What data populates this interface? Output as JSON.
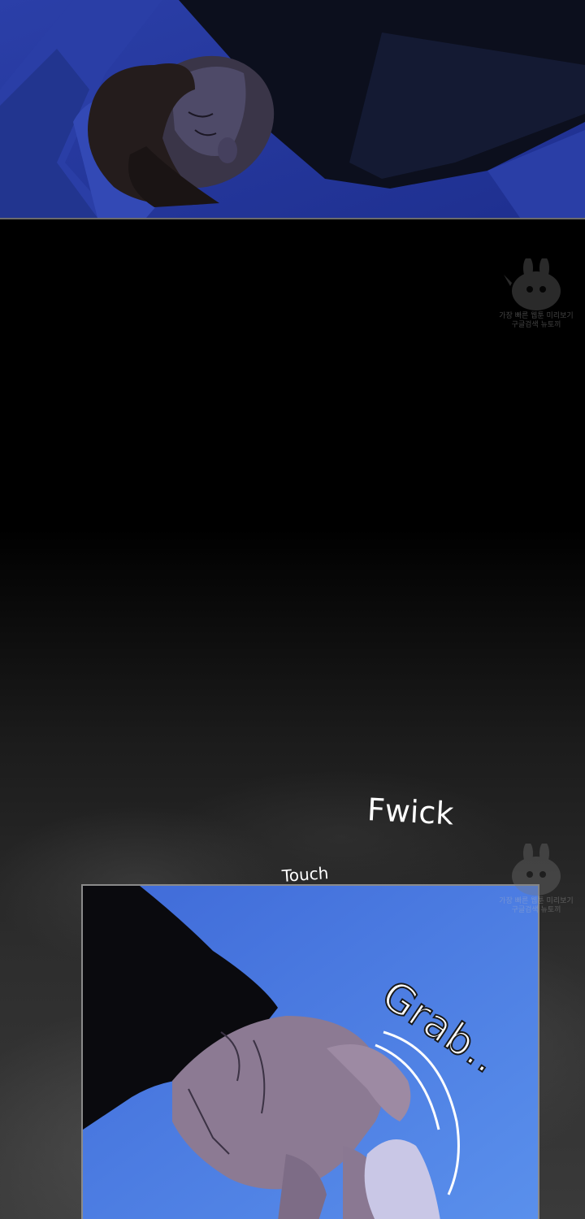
{
  "panels": {
    "top": {
      "description_icon": "sleeping-figure"
    },
    "bottom": {
      "description_icon": "hands-grasping"
    }
  },
  "sound_effects": {
    "fwick": "Fwick",
    "touch": "Touch",
    "grab": "Grab.."
  },
  "watermark": {
    "line1": "가장 빠른 웹툰 미리보기",
    "line2": "구글검색 뉴토끼"
  },
  "colors": {
    "panel_top_bg": "#2c3fa6",
    "panel_bottom_bg": "#4f7fe0",
    "fog_gray": "#3a3a3a",
    "sfx_text": "#ffffff"
  }
}
